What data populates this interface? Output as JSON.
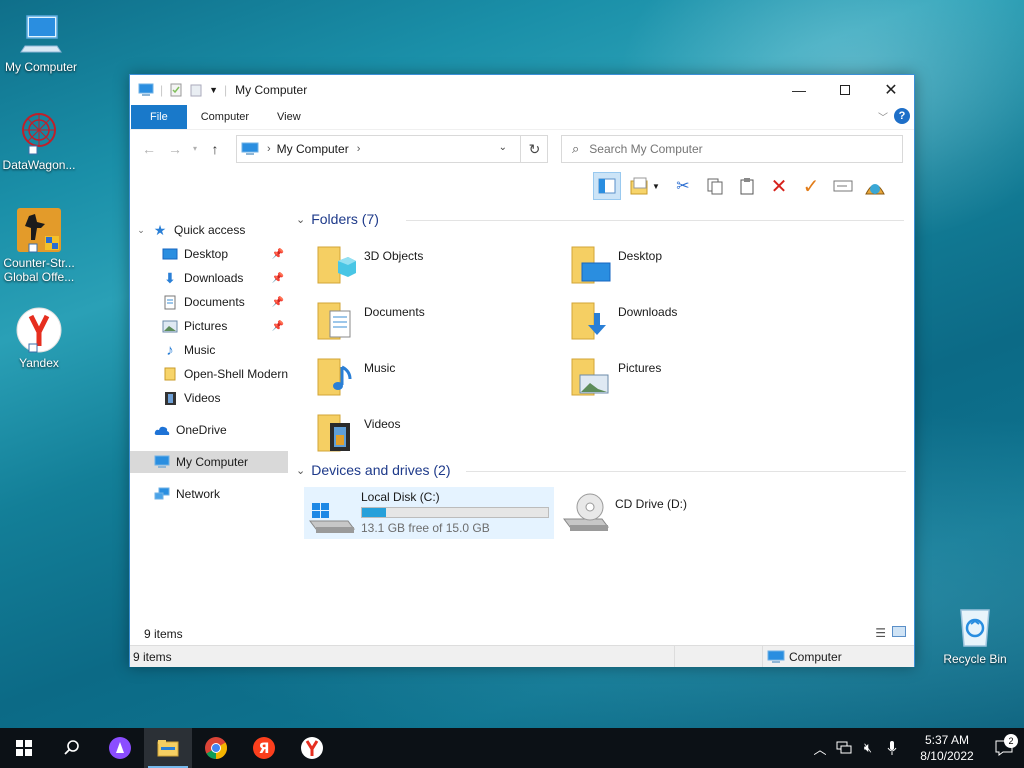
{
  "desktop": {
    "icons": [
      {
        "label": "My Computer"
      },
      {
        "label": "DataWagon..."
      },
      {
        "label": "Counter-Str... Global Offe..."
      },
      {
        "label": "Yandex"
      },
      {
        "label": "Recycle Bin"
      }
    ]
  },
  "window": {
    "title": "My Computer",
    "ribbon_tabs": [
      "File",
      "Computer",
      "View"
    ],
    "help_label": "?",
    "address": {
      "segment": "My Computer"
    },
    "search": {
      "placeholder": "Search My Computer"
    },
    "sidebar": {
      "quick_access": "Quick access",
      "items": [
        "Desktop",
        "Downloads",
        "Documents",
        "Pictures",
        "Music",
        "Open-Shell Modern",
        "Videos"
      ],
      "onedrive": "OneDrive",
      "my_computer": "My Computer",
      "network": "Network"
    },
    "folders": {
      "header": "Folders (7)",
      "items": [
        "3D Objects",
        "Desktop",
        "Documents",
        "Downloads",
        "Music",
        "Pictures",
        "Videos"
      ]
    },
    "devices": {
      "header": "Devices and drives (2)",
      "local_disk": {
        "label": "Local Disk (C:)",
        "free": "13.1 GB free of 15.0 GB",
        "used_fraction": 0.127
      },
      "cd_drive": {
        "label": "CD Drive (D:)"
      }
    },
    "status_count": "9 items",
    "bottom_count": "9 items",
    "bottom_location": "Computer"
  },
  "taskbar": {
    "time": "5:37 AM",
    "date": "8/10/2022",
    "notification_count": "2"
  },
  "colors": {
    "accent": "#1979ca",
    "selection": "#cce4f7",
    "progress": "#26a0da"
  }
}
